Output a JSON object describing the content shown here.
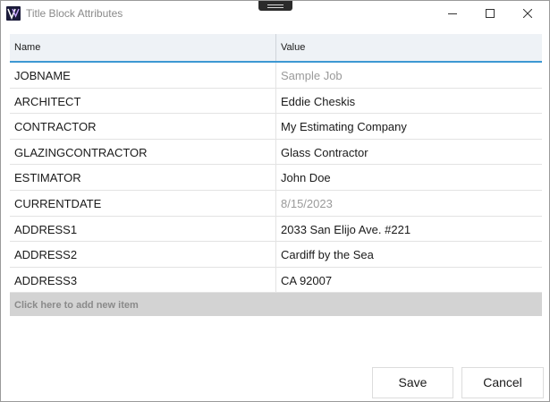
{
  "window": {
    "title": "Title Block Attributes"
  },
  "grid": {
    "columns": {
      "name": "Name",
      "value": "Value"
    },
    "rows": [
      {
        "name": "JOBNAME",
        "value": "Sample Job",
        "muted": true
      },
      {
        "name": "ARCHITECT",
        "value": "Eddie Cheskis",
        "muted": false
      },
      {
        "name": "CONTRACTOR",
        "value": "My Estimating Company",
        "muted": false
      },
      {
        "name": "GLAZINGCONTRACTOR",
        "value": "Glass Contractor",
        "muted": false
      },
      {
        "name": "ESTIMATOR",
        "value": "John Doe",
        "muted": false
      },
      {
        "name": "CURRENTDATE",
        "value": "8/15/2023",
        "muted": true
      },
      {
        "name": "ADDRESS1",
        "value": "2033 San Elijo Ave. #221",
        "muted": false
      },
      {
        "name": "ADDRESS2",
        "value": "Cardiff by the Sea",
        "muted": false
      },
      {
        "name": "ADDRESS3",
        "value": "CA 92007",
        "muted": false
      }
    ],
    "add_item_label": "Click here to add new item"
  },
  "buttons": {
    "save": "Save",
    "cancel": "Cancel"
  },
  "colors": {
    "header_accent": "#3d98d3",
    "muted_text": "#9a9a9a"
  },
  "icons": [
    "app-logo-icon",
    "minimize-icon",
    "maximize-icon",
    "close-icon",
    "drag-grip-icon"
  ]
}
